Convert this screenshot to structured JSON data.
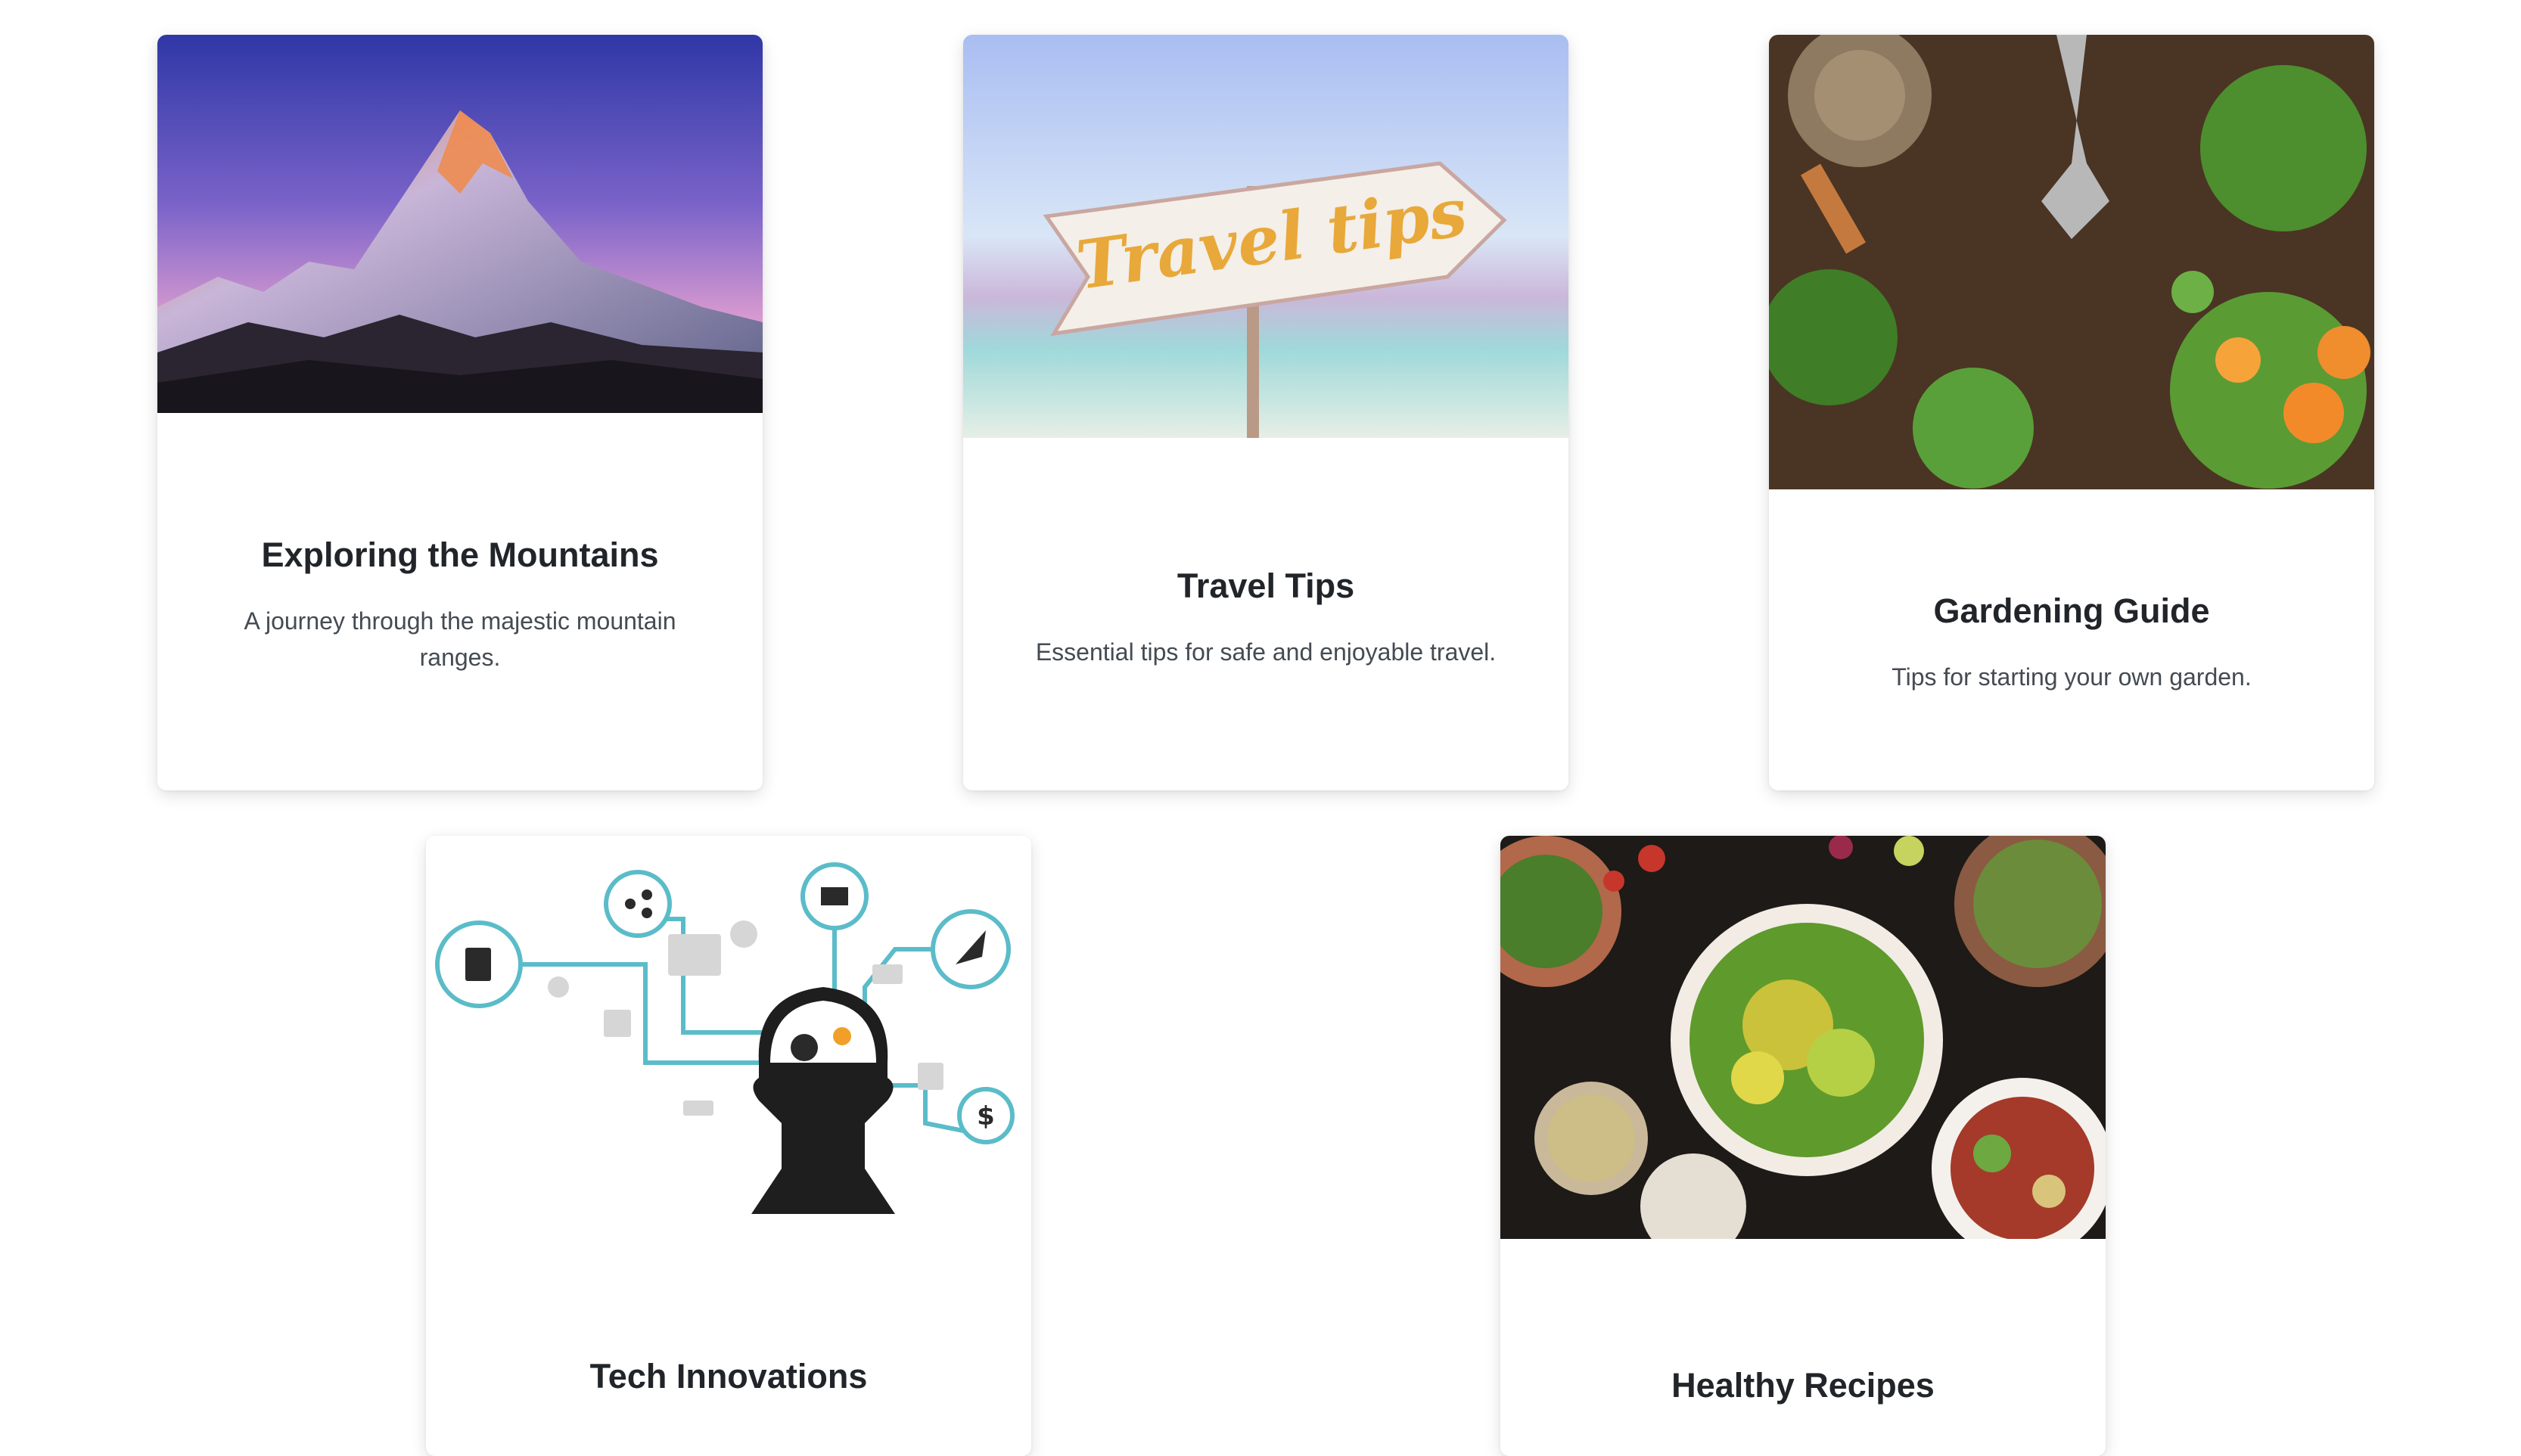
{
  "cards": [
    {
      "title": "Exploring the Mountains",
      "text": "A journey through the majestic mountain ranges.",
      "image": "mountain-photo"
    },
    {
      "title": "Travel Tips",
      "text": "Essential tips for safe and enjoyable travel.",
      "image": "travel-tips-sign-photo",
      "sign_text": "Travel tips"
    },
    {
      "title": "Gardening Guide",
      "text": "Tips for starting your own garden.",
      "image": "garden-soil-tools-photo"
    },
    {
      "title": "Tech Innovations",
      "text": "",
      "image": "tech-head-icons-illustration",
      "icon_text": "$"
    },
    {
      "title": "Healthy Recipes",
      "text": "",
      "image": "salad-bowls-photo"
    }
  ]
}
